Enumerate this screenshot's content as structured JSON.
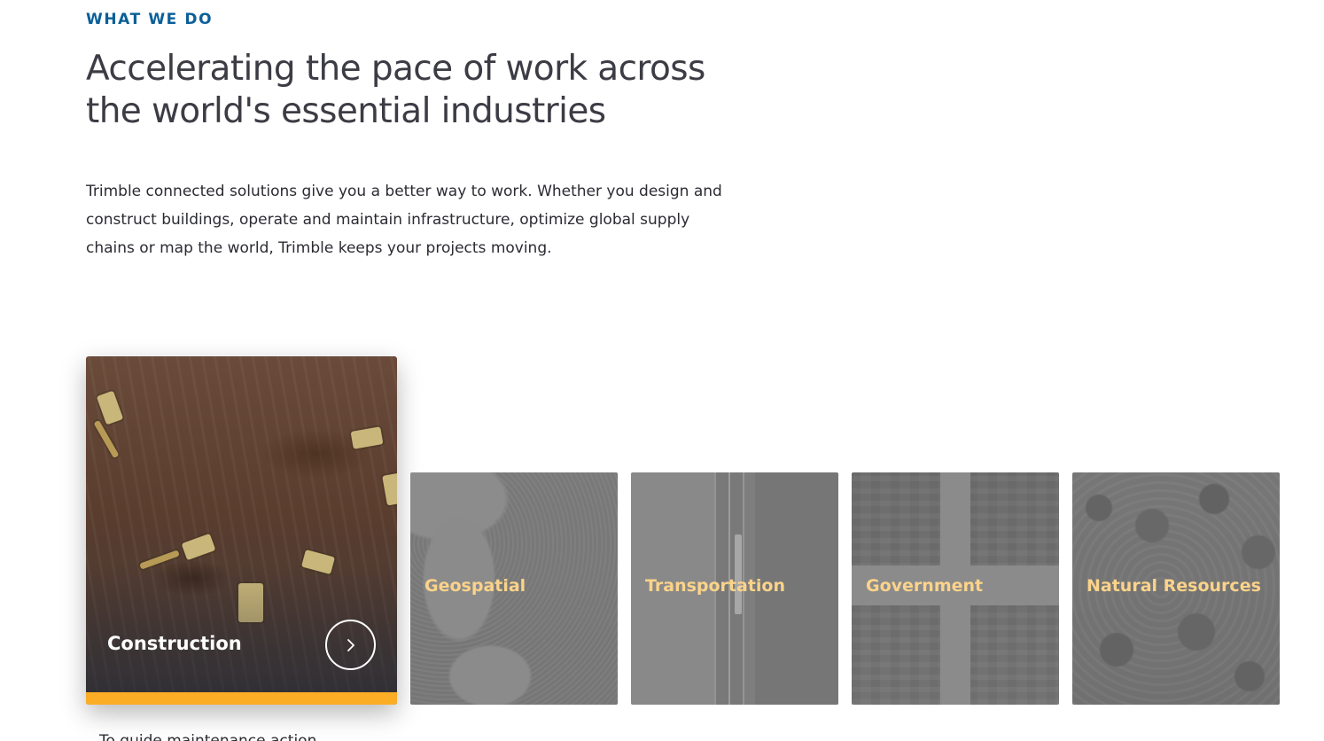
{
  "section": {
    "eyebrow": "WHAT WE DO",
    "headline": "Accelerating the pace of work across the world's essential industries",
    "intro": "Trimble connected solutions give you a better way to work. Whether you design and construct buildings, operate and maintain infrastructure, optimize global supply chains or map the world, Trimble keeps your projects moving."
  },
  "industries": {
    "active": {
      "label": "Construction",
      "arrow_icon": "chevron-right-icon"
    },
    "cards": [
      {
        "label": "Geospatial"
      },
      {
        "label": "Transportation"
      },
      {
        "label": "Government"
      },
      {
        "label": "Natural Resources"
      }
    ]
  },
  "below": {
    "text": "To guide maintenance action"
  },
  "colors": {
    "eyebrow": "#0b5f99",
    "accent": "#fbad25",
    "card_label": "#fbd38a"
  }
}
